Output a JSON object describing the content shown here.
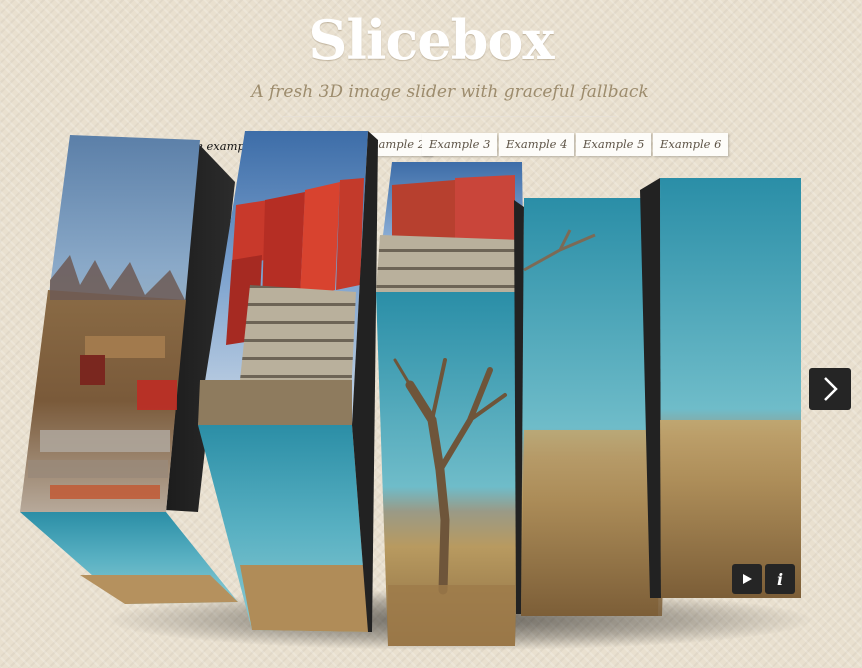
{
  "header": {
    "title": "Slicebox",
    "subtitle": "A fresh 3D image slider with graceful fallback"
  },
  "nav": {
    "links": [
      {
        "label": "Example 1",
        "visible": "e examp"
      },
      {
        "label": "Example 2",
        "visible": "xample 2"
      },
      {
        "label": "Example 3",
        "visible": "Example 3"
      },
      {
        "label": "Example 4",
        "visible": "Example 4"
      },
      {
        "label": "Example 5",
        "visible": "Example 5"
      },
      {
        "label": "Example 6",
        "visible": "Example 6"
      }
    ]
  },
  "slider": {
    "next_icon": "chevron-right-icon",
    "play_icon": "play-icon",
    "info_label": "i",
    "images": {
      "prev_image": "prairie-landscape",
      "current_image": "red-phone-booths",
      "next_image": "dead-tree-field"
    }
  }
}
